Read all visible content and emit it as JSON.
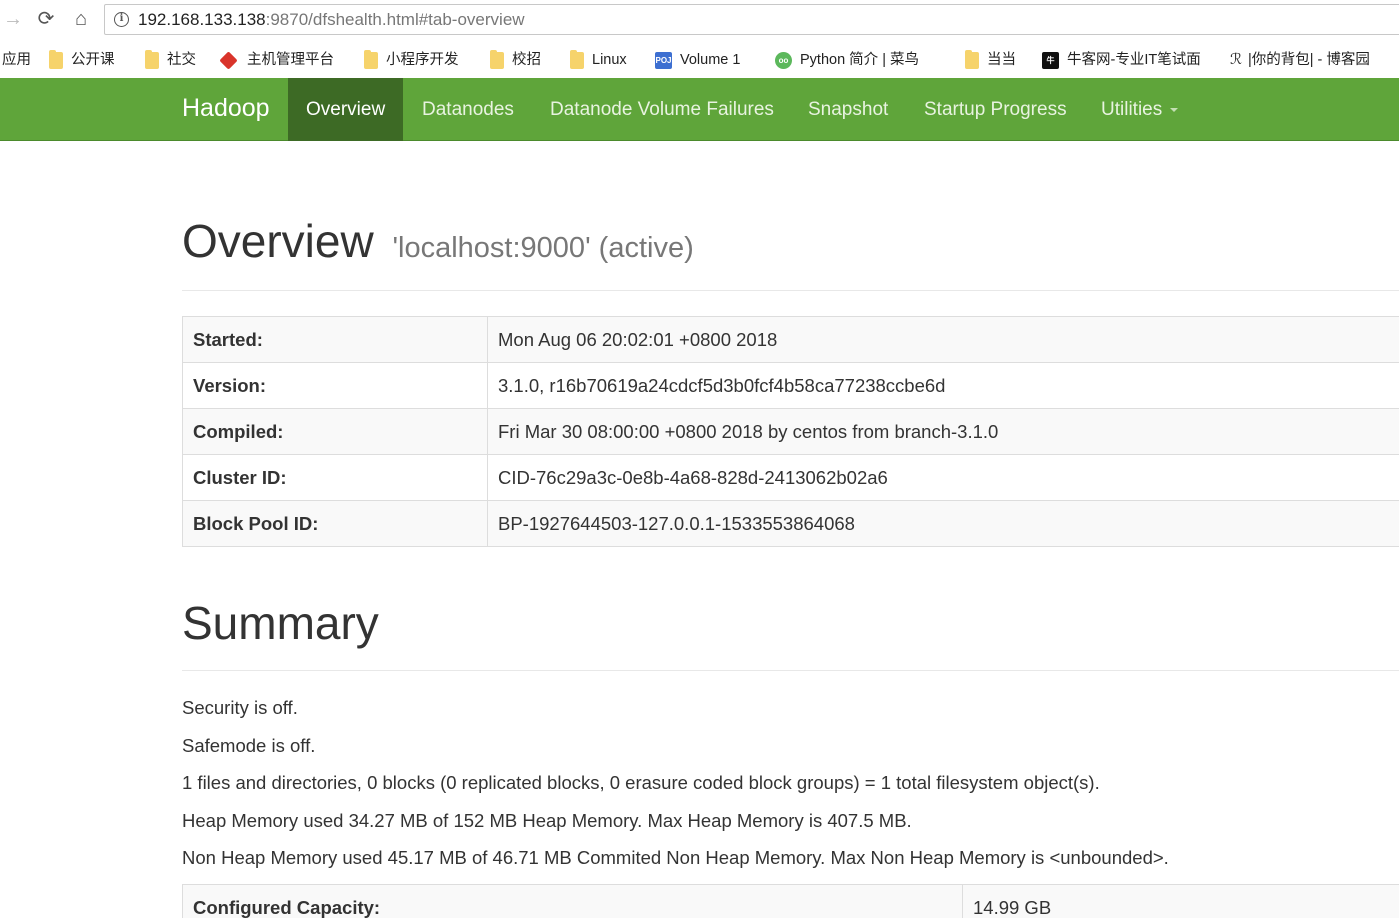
{
  "browser": {
    "url_host": "192.168.133.138",
    "url_rest": ":9870/dfshealth.html#tab-overview",
    "back_icon": "arrow-right-icon",
    "reload_icon": "reload-icon",
    "home_icon": "home-icon",
    "bookmarks": [
      {
        "label": "应用",
        "icon": "none"
      },
      {
        "label": "公开课",
        "icon": "folder"
      },
      {
        "label": "社交",
        "icon": "folder"
      },
      {
        "label": "主机管理平台",
        "icon": "red-diamond"
      },
      {
        "label": "小程序开发",
        "icon": "folder"
      },
      {
        "label": "校招",
        "icon": "folder"
      },
      {
        "label": "Linux",
        "icon": "folder"
      },
      {
        "label": "Volume 1",
        "icon": "poj"
      },
      {
        "label": "Python 简介 | 菜鸟",
        "icon": "runoob"
      },
      {
        "label": "当当",
        "icon": "folder"
      },
      {
        "label": "牛客网-专业IT笔试面",
        "icon": "nowcoder"
      },
      {
        "label": "|你的背包| - 博客园",
        "icon": "cnblogs"
      }
    ]
  },
  "navbar": {
    "brand": "Hadoop",
    "items": [
      "Overview",
      "Datanodes",
      "Datanode Volume Failures",
      "Snapshot",
      "Startup Progress",
      "Utilities"
    ],
    "active": "Overview",
    "accent": "#5fa53a",
    "active_bg": "#3d6a25"
  },
  "overview": {
    "title": "Overview",
    "subtitle": "'localhost:9000' (active)",
    "rows": [
      {
        "key": "Started:",
        "value": "Mon Aug 06 20:02:01 +0800 2018"
      },
      {
        "key": "Version:",
        "value": "3.1.0, r16b70619a24cdcf5d3b0fcf4b58ca77238ccbe6d"
      },
      {
        "key": "Compiled:",
        "value": "Fri Mar 30 08:00:00 +0800 2018 by centos from branch-3.1.0"
      },
      {
        "key": "Cluster ID:",
        "value": "CID-76c29a3c-0e8b-4a68-828d-2413062b02a6"
      },
      {
        "key": "Block Pool ID:",
        "value": "BP-1927644503-127.0.0.1-1533553864068"
      }
    ]
  },
  "summary": {
    "title": "Summary",
    "lines": [
      "Security is off.",
      "Safemode is off.",
      "1 files and directories, 0 blocks (0 replicated blocks, 0 erasure coded block groups) = 1 total filesystem object(s).",
      "Heap Memory used 34.27 MB of 152 MB Heap Memory. Max Heap Memory is 407.5 MB.",
      "Non Heap Memory used 45.17 MB of 46.71 MB Commited Non Heap Memory. Max Non Heap Memory is <unbounded>."
    ],
    "table": [
      {
        "key": "Configured Capacity:",
        "value": "14.99 GB"
      }
    ]
  }
}
